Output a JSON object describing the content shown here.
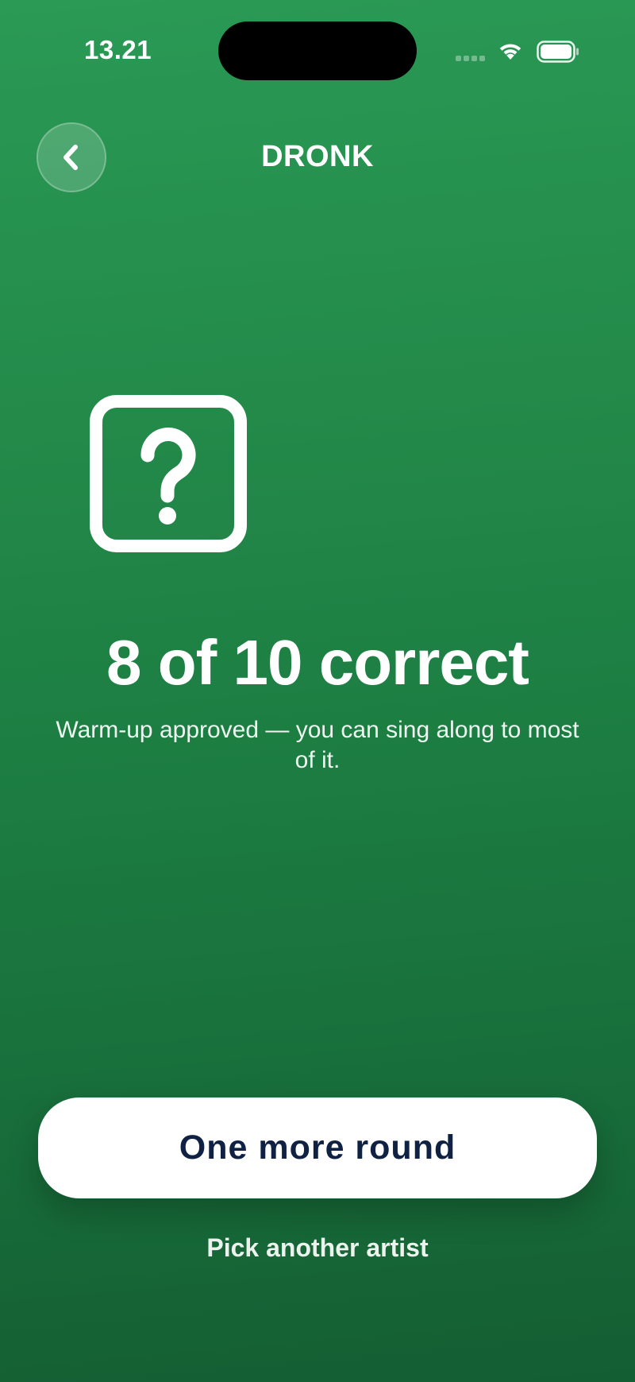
{
  "status_bar": {
    "time": "13.21",
    "wifi_icon": "wifi-icon",
    "battery_icon": "battery-icon"
  },
  "nav": {
    "back_icon": "chevron-left-icon",
    "title": "DRONK"
  },
  "result": {
    "icon": "question-mark-square-icon",
    "score_text": "8 of 10 correct",
    "message": "Warm-up approved — you can sing along to most of it."
  },
  "actions": {
    "primary_label": "One more round",
    "secondary_label": "Pick another artist"
  },
  "colors": {
    "background_top": "#2a9a55",
    "background_bottom": "#145e33",
    "primary_button_bg": "#ffffff",
    "primary_button_text": "#0f2244"
  }
}
